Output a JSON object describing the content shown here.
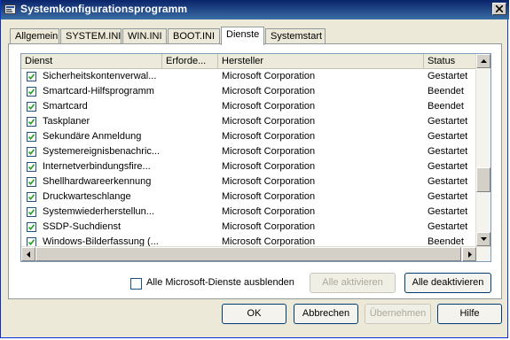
{
  "window": {
    "title": "Systemkonfigurationsprogramm"
  },
  "tabs": [
    {
      "label": "Allgemein"
    },
    {
      "label": "SYSTEM.INI"
    },
    {
      "label": "WIN.INI"
    },
    {
      "label": "BOOT.INI"
    },
    {
      "label": "Dienste",
      "active": true
    },
    {
      "label": "Systemstart"
    }
  ],
  "services": {
    "columns": {
      "name": "Dienst",
      "required": "Erforde...",
      "manufacturer": "Hersteller",
      "status": "Status"
    },
    "rows": [
      {
        "name": "Sicherheitskontenverwal...",
        "required": "",
        "manufacturer": "Microsoft Corporation",
        "status": "Gestartet",
        "checked": true
      },
      {
        "name": "Smartcard-Hilfsprogramm",
        "required": "",
        "manufacturer": "Microsoft Corporation",
        "status": "Beendet",
        "checked": true
      },
      {
        "name": "Smartcard",
        "required": "",
        "manufacturer": "Microsoft Corporation",
        "status": "Beendet",
        "checked": true
      },
      {
        "name": "Taskplaner",
        "required": "",
        "manufacturer": "Microsoft Corporation",
        "status": "Gestartet",
        "checked": true
      },
      {
        "name": "Sekundäre Anmeldung",
        "required": "",
        "manufacturer": "Microsoft Corporation",
        "status": "Gestartet",
        "checked": true
      },
      {
        "name": "Systemereignisbenachric...",
        "required": "",
        "manufacturer": "Microsoft Corporation",
        "status": "Gestartet",
        "checked": true
      },
      {
        "name": "Internetverbindungsfire...",
        "required": "",
        "manufacturer": "Microsoft Corporation",
        "status": "Gestartet",
        "checked": true
      },
      {
        "name": "Shellhardwareerkennung",
        "required": "",
        "manufacturer": "Microsoft Corporation",
        "status": "Gestartet",
        "checked": true
      },
      {
        "name": "Druckwarteschlange",
        "required": "",
        "manufacturer": "Microsoft Corporation",
        "status": "Gestartet",
        "checked": true
      },
      {
        "name": "Systemwiederherstellun...",
        "required": "",
        "manufacturer": "Microsoft Corporation",
        "status": "Gestartet",
        "checked": true
      },
      {
        "name": "SSDP-Suchdienst",
        "required": "",
        "manufacturer": "Microsoft Corporation",
        "status": "Gestartet",
        "checked": true
      },
      {
        "name": "Windows-Bilderfassung (...",
        "required": "",
        "manufacturer": "Microsoft Corporation",
        "status": "Beendet",
        "checked": true
      }
    ]
  },
  "options": {
    "hide_ms_label": "Alle Microsoft-Dienste ausblenden",
    "hide_ms_checked": false
  },
  "buttons": {
    "enable_all": "Alle aktivieren",
    "disable_all": "Alle deaktivieren",
    "ok": "OK",
    "cancel": "Abbrechen",
    "apply": "Übernehmen",
    "help": "Hilfe"
  },
  "colors": {
    "titlebar": "#0a246a",
    "face": "#ece9d8",
    "panel": "#ffffff"
  }
}
